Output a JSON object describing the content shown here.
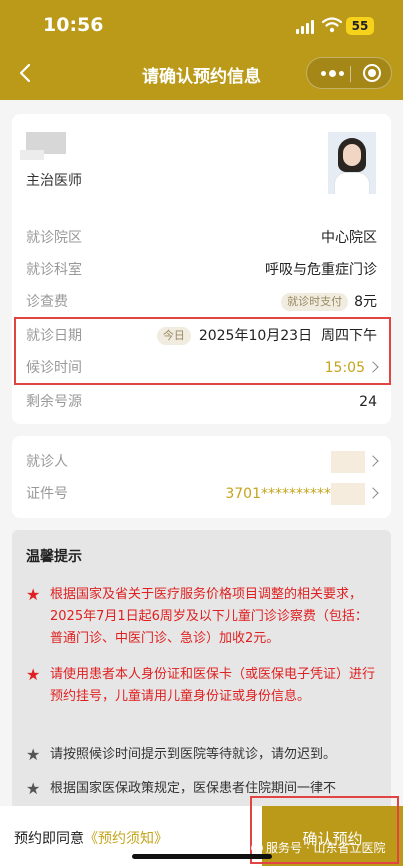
{
  "status_bar": {
    "time": "10:56",
    "battery": "55"
  },
  "nav": {
    "title": "请确认预约信息"
  },
  "doctor": {
    "title": "主治医师"
  },
  "info": {
    "hospital_label": "就诊院区",
    "hospital_value": "中心院区",
    "dept_label": "就诊科室",
    "dept_value": "呼吸与危重症门诊",
    "fee_label": "诊查费",
    "fee_badge": "就诊时支付",
    "fee_value": "8元",
    "date_label": "就诊日期",
    "date_badge": "今日",
    "date_value": "2025年10月23日",
    "date_period": "周四下午",
    "time_label": "候诊时间",
    "time_value": "15:05",
    "remain_label": "剩余号源",
    "remain_value": "24"
  },
  "patient": {
    "patient_label": "就诊人",
    "id_label": "证件号",
    "id_value": "3701**********"
  },
  "tips": {
    "title": "温馨提示",
    "star": "★",
    "items": [
      "根据国家及省关于医疗服务价格项目调整的相关要求，2025年7月1日起6周岁及以下儿童门诊诊察费（包括：普通门诊、中医门诊、急诊）加收2元。",
      "请使用患者本人身份证和医保卡（或医保电子凭证）进行预约挂号，儿童请用儿童身份证或身份信息。",
      "请按照候诊时间提示到医院等待就诊，请勿迟到。",
      "根据国家医保政策规定，医保患者住院期间一律不"
    ]
  },
  "bottom": {
    "agree_prefix": "预约即同意",
    "agree_link": "《预约须知》",
    "confirm": "确认预约",
    "watermark": "服务号 · 山东省立医院"
  },
  "colors": {
    "brand": "#bb9a1a",
    "gold_text": "#c4a41d",
    "highlight": "#e24444",
    "tip_red": "#e02020"
  }
}
